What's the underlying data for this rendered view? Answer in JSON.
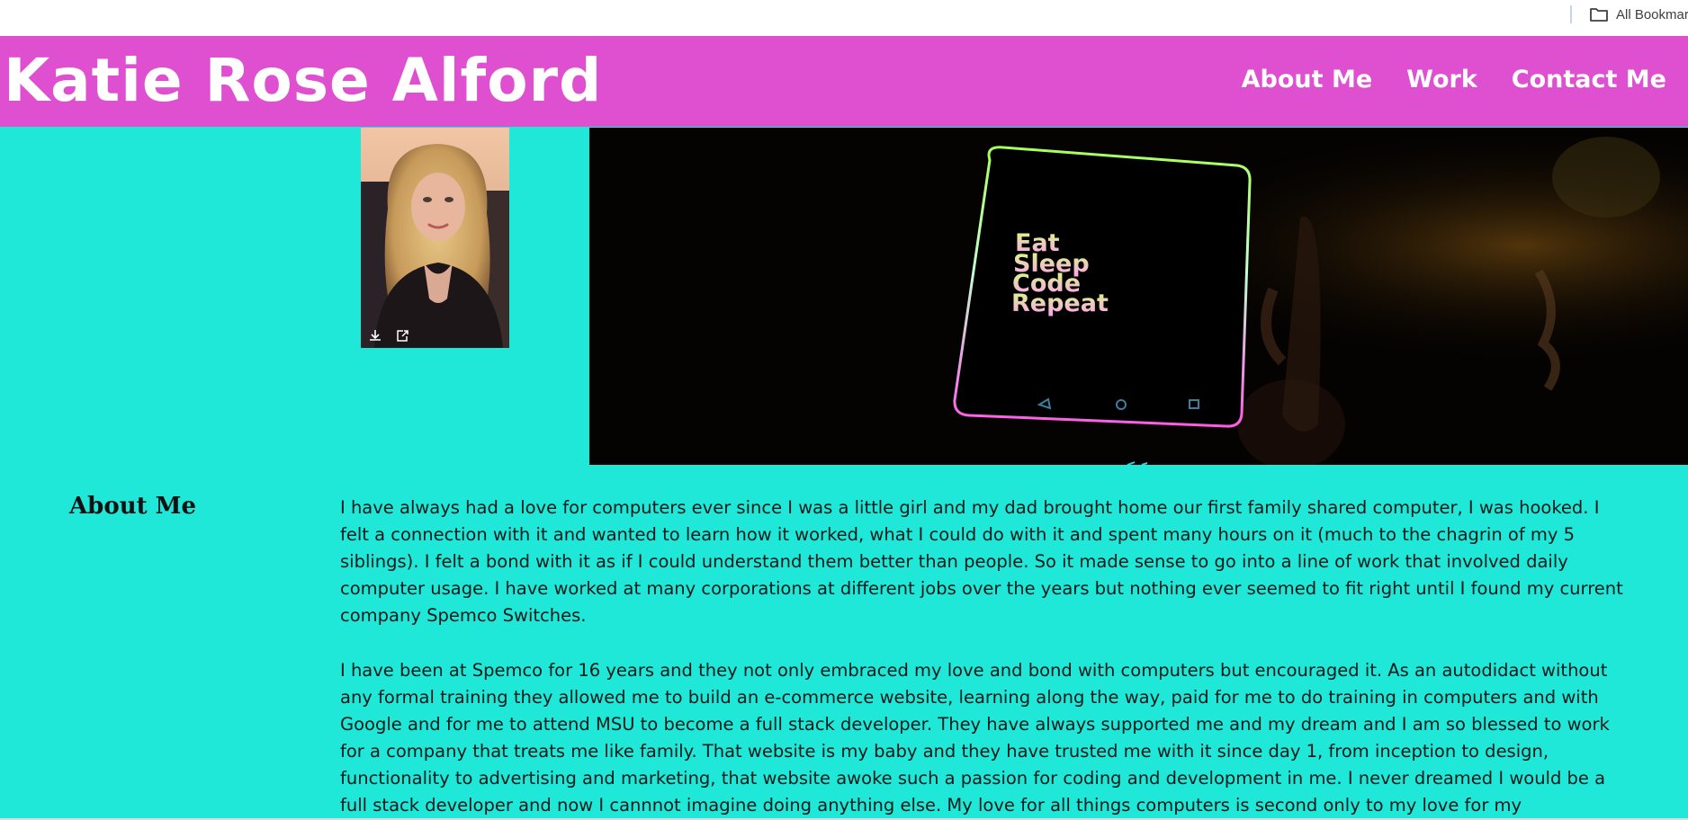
{
  "bookmarks_bar": {
    "all_bookmarks_label": "All Bookmar",
    "icon": "folder-icon"
  },
  "header": {
    "title": "Katie Rose Alford",
    "background_color": "#de50d0",
    "nav": [
      {
        "label": "About Me"
      },
      {
        "label": "Work"
      },
      {
        "label": "Contact Me"
      }
    ]
  },
  "main": {
    "background_color": "#1fe8d8",
    "hero_phone_text": [
      "Eat",
      "Sleep",
      "Code",
      "Repeat"
    ],
    "photo_actions": [
      "download-icon",
      "share-icon"
    ]
  },
  "about": {
    "heading": "About Me",
    "paragraphs": [
      "I have always had a love for computers ever since I was a little girl and my dad brought home our first family shared computer, I was hooked. I felt a connection with it and wanted to learn how it worked, what I could do with it and spent many hours on it (much to the chagrin of my 5 siblings). I felt a bond with it as if I could understand them better than people. So it made sense to go into a line of work that involved daily computer usage. I have worked at many corporations at different jobs over the years but nothing ever seemed to fit right until I found my current company Spemco Switches.",
      "I have been at Spemco for 16 years and they not only embraced my love and bond with computers but encouraged it. As an autodidact without any formal training they allowed me to build an e-commerce website, learning along the way, paid for me to do training in computers and with Google and for me to attend MSU to become a full stack developer. They have always supported me and my dream and I am so blessed to work for a company that treats me like family. That website is my baby and they have trusted me with it since day 1, from inception to design, functionality to advertising and marketing, that website awoke such a passion for coding and development in me. I never dreamed I would be a full stack developer and now I cannnot imagine doing anything else. My love for all things computers is second only to my love for my"
    ]
  }
}
